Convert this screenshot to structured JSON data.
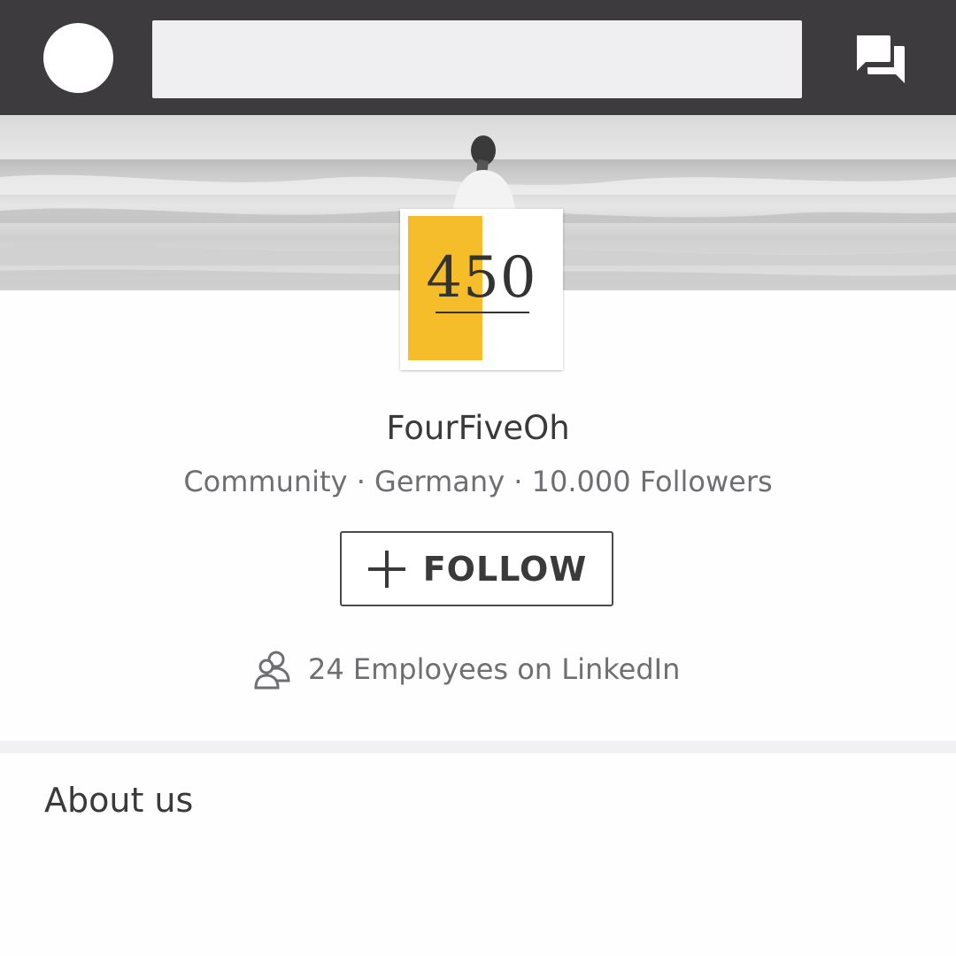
{
  "topbar": {
    "search": {
      "value": "",
      "placeholder": ""
    },
    "messages_icon": "messages-icon",
    "avatar": "profile-avatar"
  },
  "cover": {
    "description_icon": "cover-photo"
  },
  "logo": {
    "text": "450",
    "accent_color": "#f5bd2a"
  },
  "company": {
    "name": "FourFiveOh",
    "meta": "Community · Germany · 10.000 Followers",
    "follow_label": "FOLLOW",
    "employees_label": "24 Employees on LinkedIn"
  },
  "about": {
    "title": "About us"
  },
  "colors": {
    "topbar": "#3d3b3e",
    "search_bg": "#efeef0",
    "text_dark": "#3a3a3a",
    "text_muted": "#6f6e72",
    "divider": "#f1f0f2"
  }
}
